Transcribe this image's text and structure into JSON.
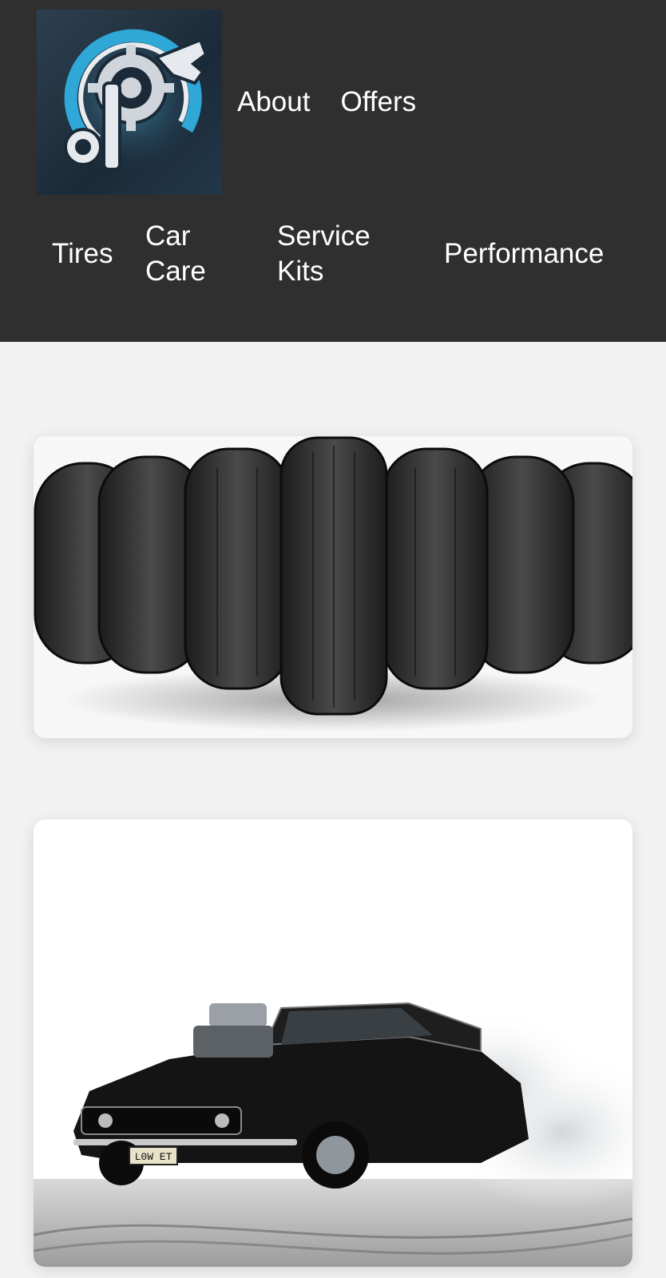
{
  "header": {
    "logo_icon": "wrench-gear-logo-icon",
    "top_nav": [
      {
        "label": "About"
      },
      {
        "label": "Offers"
      }
    ],
    "categories": [
      {
        "line1": "Tires",
        "line2": ""
      },
      {
        "line1": "Car",
        "line2": "Care"
      },
      {
        "line1": "Service",
        "line2": "Kits"
      },
      {
        "line1": "Performance",
        "line2": ""
      }
    ]
  },
  "cards": [
    {
      "image": "tires-row-image"
    },
    {
      "image": "muscle-car-burnout-image",
      "plate": "L0W ET"
    }
  ],
  "colors": {
    "header_bg": "#2f2f2f",
    "page_bg": "#f2f2f2",
    "accent": "#2fa8d8"
  }
}
